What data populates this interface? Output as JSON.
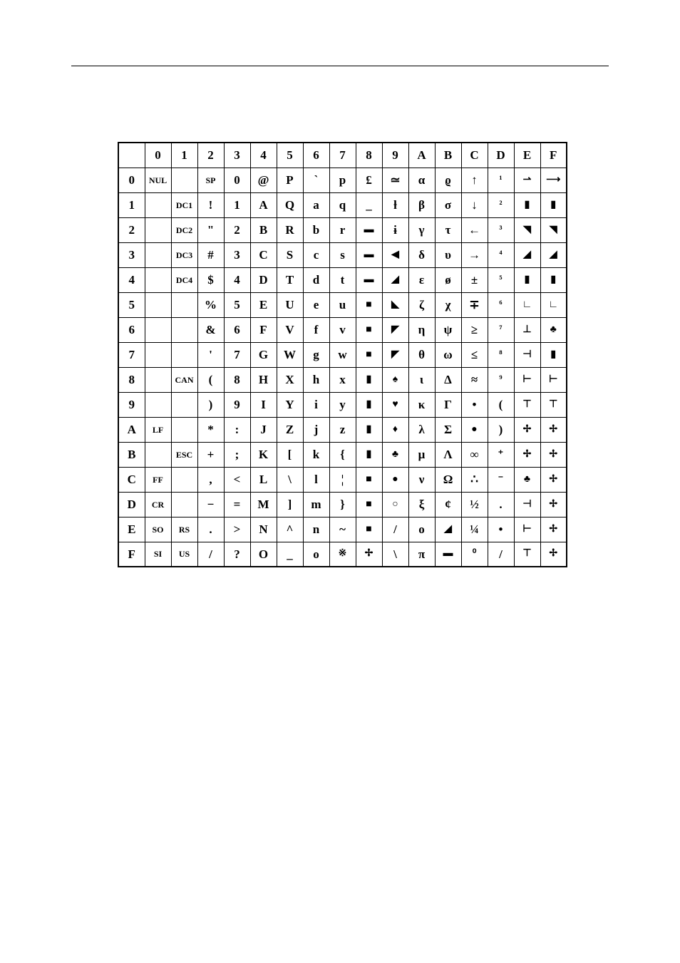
{
  "chart_data": {
    "type": "table",
    "title": "Character Code Table (16x16)",
    "col_headers": [
      "0",
      "1",
      "2",
      "3",
      "4",
      "5",
      "6",
      "7",
      "8",
      "9",
      "A",
      "B",
      "C",
      "D",
      "E",
      "F"
    ],
    "row_headers": [
      "0",
      "1",
      "2",
      "3",
      "4",
      "5",
      "6",
      "7",
      "8",
      "9",
      "A",
      "B",
      "C",
      "D",
      "E",
      "F"
    ],
    "cells": [
      [
        "NUL",
        "",
        "SP",
        "0",
        "@",
        "P",
        "`",
        "p",
        "£",
        "≃",
        "α",
        "ϱ",
        "↑",
        "¹",
        "⇀",
        "⟶"
      ],
      [
        "",
        "DC1",
        "!",
        "1",
        "A",
        "Q",
        "a",
        "q",
        "_",
        "ƚ",
        "β",
        "σ",
        "↓",
        "²",
        "▮",
        "▮"
      ],
      [
        "",
        "DC2",
        "\"",
        "2",
        "B",
        "R",
        "b",
        "r",
        "▬",
        "ɨ",
        "γ",
        "τ",
        "←",
        "³",
        "◥",
        "◥"
      ],
      [
        "",
        "DC3",
        "#",
        "3",
        "C",
        "S",
        "c",
        "s",
        "▬",
        "◀",
        "δ",
        "υ",
        "→",
        "⁴",
        "◢",
        "◢"
      ],
      [
        "",
        "DC4",
        "$",
        "4",
        "D",
        "T",
        "d",
        "t",
        "▬",
        "◢",
        "ε",
        "ø",
        "±",
        "⁵",
        "▮",
        "▮"
      ],
      [
        "",
        "",
        "%",
        "5",
        "E",
        "U",
        "e",
        "u",
        "■",
        "◣",
        "ζ",
        "χ",
        "∓",
        "⁶",
        "∟",
        "∟"
      ],
      [
        "",
        "",
        "&",
        "6",
        "F",
        "V",
        "f",
        "v",
        "■",
        "◤",
        "η",
        "ψ",
        "≥",
        "⁷",
        "⊥",
        "♣"
      ],
      [
        "",
        "",
        "'",
        "7",
        "G",
        "W",
        "g",
        "w",
        "■",
        "◤",
        "θ",
        "ω",
        "≤",
        "⁸",
        "⊣",
        "▮"
      ],
      [
        "",
        "CAN",
        "(",
        "8",
        "H",
        "X",
        "h",
        "x",
        "▮",
        "♠",
        "ι",
        "Δ",
        "≈",
        "⁹",
        "⊢",
        "⊢"
      ],
      [
        "",
        "",
        ")",
        "9",
        "I",
        "Y",
        "i",
        "y",
        "▮",
        "♥",
        "κ",
        "Γ",
        "•",
        "(",
        "⊤",
        "⊤"
      ],
      [
        "LF",
        "",
        "*",
        ":",
        "J",
        "Z",
        "j",
        "z",
        "▮",
        "♦",
        "λ",
        "Σ",
        "●",
        ")",
        "✢",
        "✢"
      ],
      [
        "",
        "ESC",
        "+",
        ";",
        "K",
        "[",
        "k",
        "{",
        "▮",
        "♣",
        "μ",
        "Λ",
        "∞",
        "⁺",
        "✢",
        "✢"
      ],
      [
        "FF",
        "",
        ",",
        "<",
        "L",
        "\\",
        "l",
        "¦",
        "■",
        "●",
        "ν",
        "Ω",
        "∴",
        "⁻",
        "♣",
        "✢"
      ],
      [
        "CR",
        "",
        "−",
        "=",
        "M",
        "]",
        "m",
        "}",
        "■",
        "○",
        "ξ",
        "¢",
        "½",
        ".",
        "⊣",
        "✢"
      ],
      [
        "SO",
        "RS",
        ".",
        ">",
        "N",
        "^",
        "n",
        "~",
        "■",
        "/",
        "ο",
        "◢",
        "¼",
        "•",
        "⊢",
        "✢"
      ],
      [
        "SI",
        "US",
        "/",
        "?",
        "O",
        "_",
        "o",
        "※",
        "✢",
        "\\",
        "π",
        "▬",
        "⁰",
        "/",
        "⊤",
        "✢"
      ]
    ]
  }
}
